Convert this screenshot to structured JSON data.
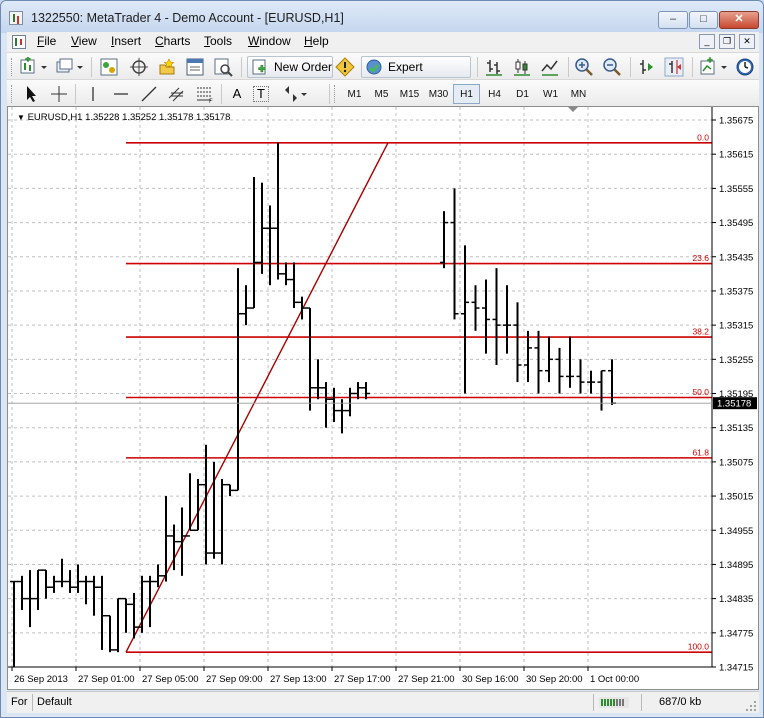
{
  "window": {
    "title": "1322550: MetaTrader 4 - Demo Account - [EURUSD,H1]",
    "minimize_glyph": "–",
    "maximize_glyph": "□",
    "close_glyph": "✕"
  },
  "menu": {
    "items": [
      "File",
      "View",
      "Insert",
      "Charts",
      "Tools",
      "Window",
      "Help"
    ],
    "mdi_min": "_",
    "mdi_restore": "❐",
    "mdi_close": "✕"
  },
  "toolbar": {
    "new_order_label": "New Order",
    "expert_advisors_label": "Expert Advisors",
    "timeframes": [
      "M1",
      "M5",
      "M15",
      "M30",
      "H1",
      "H4",
      "D1",
      "W1",
      "MN"
    ],
    "active_timeframe": "H1",
    "text_tool_label": "A",
    "label_tool_label": "T"
  },
  "icons": {
    "new_chart": "new-chart-icon",
    "profiles": "profiles-icon",
    "market_watch": "market-watch-icon",
    "navigator": "navigator-icon",
    "favorites": "favorites-icon",
    "terminal": "terminal-icon",
    "tester": "tester-icon",
    "zoom_in": "zoom-in-icon",
    "zoom_out": "zoom-out-icon",
    "clock": "clock-icon"
  },
  "colors": {
    "fib_line": "#cc0000",
    "candle": "#000000",
    "grid": "#c0c0c0",
    "price_label_bg": "#000000"
  },
  "chart_data": {
    "type": "ohlc-bar",
    "symbol_header": "EURUSD,H1  1.35228 1.35252 1.35178 1.35178",
    "current_price": "1.35178",
    "y_ticks": [
      "1.35675",
      "1.35615",
      "1.35555",
      "1.35495",
      "1.35435",
      "1.35375",
      "1.35315",
      "1.35255",
      "1.35195",
      "1.35135",
      "1.35075",
      "1.35015",
      "1.34955",
      "1.34895",
      "1.34835",
      "1.34775",
      "1.34715"
    ],
    "y_range": [
      1.34715,
      1.35675
    ],
    "x_ticks": [
      "26 Sep 2013",
      "27 Sep 01:00",
      "27 Sep 05:00",
      "27 Sep 09:00",
      "27 Sep 13:00",
      "27 Sep 17:00",
      "27 Sep 21:00",
      "30 Sep 16:00",
      "30 Sep 20:00",
      "1 Oct 00:00"
    ],
    "fibonacci": {
      "levels": [
        {
          "label": "0.0",
          "price": 1.35635
        },
        {
          "label": "23.6",
          "price": 1.35423
        },
        {
          "label": "38.2",
          "price": 1.35294
        },
        {
          "label": "50.0",
          "price": 1.35188
        },
        {
          "label": "61.8",
          "price": 1.35082
        },
        {
          "label": "100.0",
          "price": 1.34741
        }
      ],
      "trendline": {
        "from_bar": 12,
        "from_price": 1.34741,
        "to_bar": 35.5,
        "to_price": 1.35635
      }
    },
    "bars": [
      [
        1.34865,
        1.34865,
        1.34715,
        1.34865
      ],
      [
        1.34865,
        1.34875,
        1.34815,
        1.34835
      ],
      [
        1.34835,
        1.34885,
        1.34785,
        1.34835
      ],
      [
        1.34835,
        1.34885,
        1.34815,
        1.34885
      ],
      [
        1.34885,
        1.34885,
        1.34835,
        1.34855
      ],
      [
        1.34855,
        1.34875,
        1.34845,
        1.34865
      ],
      [
        1.34865,
        1.34905,
        1.34855,
        1.34865
      ],
      [
        1.34865,
        1.34885,
        1.34845,
        1.34855
      ],
      [
        1.34855,
        1.34895,
        1.34845,
        1.34865
      ],
      [
        1.34865,
        1.34875,
        1.34825,
        1.34865
      ],
      [
        1.34865,
        1.34875,
        1.34805,
        1.34855
      ],
      [
        1.34855,
        1.34875,
        1.34745,
        1.34805
      ],
      [
        1.34805,
        1.34805,
        1.34741,
        1.34745
      ],
      [
        1.34745,
        1.34835,
        1.34741,
        1.34835
      ],
      [
        1.34835,
        1.34835,
        1.34775,
        1.34825
      ],
      [
        1.34825,
        1.34845,
        1.34765,
        1.34785
      ],
      [
        1.34785,
        1.34875,
        1.34775,
        1.34865
      ],
      [
        1.34865,
        1.34875,
        1.34785,
        1.34865
      ],
      [
        1.34865,
        1.34895,
        1.34855,
        1.34875
      ],
      [
        1.34875,
        1.35015,
        1.34865,
        1.34945
      ],
      [
        1.34945,
        1.34965,
        1.34885,
        1.34935
      ],
      [
        1.34935,
        1.34995,
        1.34875,
        1.34945
      ],
      [
        1.34945,
        1.35055,
        1.34955,
        1.34955
      ],
      [
        1.34955,
        1.35045,
        1.34955,
        1.35035
      ],
      [
        1.35035,
        1.35105,
        1.34895,
        1.34915
      ],
      [
        1.34915,
        1.35075,
        1.34905,
        1.34915
      ],
      [
        1.34915,
        1.35045,
        1.34895,
        1.35035
      ],
      [
        1.35035,
        1.35035,
        1.35015,
        1.35025
      ],
      [
        1.35025,
        1.35415,
        1.35025,
        1.35335
      ],
      [
        1.35335,
        1.35385,
        1.35315,
        1.35345
      ],
      [
        1.35345,
        1.35575,
        1.35345,
        1.35425
      ],
      [
        1.35425,
        1.35565,
        1.35405,
        1.35485
      ],
      [
        1.35485,
        1.35525,
        1.35385,
        1.35485
      ],
      [
        1.35485,
        1.35635,
        1.35395,
        1.35405
      ],
      [
        1.35405,
        1.35425,
        1.35385,
        1.35395
      ],
      [
        1.35395,
        1.35425,
        1.35345,
        1.35355
      ],
      [
        1.35355,
        1.35365,
        1.35325,
        1.35345
      ],
      [
        1.35345,
        1.35345,
        1.35165,
        1.35205
      ],
      [
        1.35205,
        1.35255,
        1.35185,
        1.35205
      ],
      [
        1.35205,
        1.35215,
        1.35135,
        1.35185
      ],
      [
        1.35185,
        1.35205,
        1.35145,
        1.35165
      ],
      [
        1.35165,
        1.35185,
        1.35125,
        1.35165
      ],
      [
        1.35165,
        1.35205,
        1.35155,
        1.35195
      ],
      [
        1.35195,
        1.35215,
        1.35185,
        1.35205
      ],
      [
        1.35205,
        1.35215,
        1.35185,
        1.35195
      ],
      [
        1.35425,
        1.35515,
        1.35415,
        1.35495
      ],
      [
        1.35495,
        1.35555,
        1.35325,
        1.35335
      ],
      [
        1.35335,
        1.35455,
        1.35195,
        1.35355
      ],
      [
        1.35355,
        1.35385,
        1.35305,
        1.35345
      ],
      [
        1.35345,
        1.35395,
        1.35265,
        1.35325
      ],
      [
        1.35325,
        1.35415,
        1.35245,
        1.35315
      ],
      [
        1.35315,
        1.35385,
        1.35265,
        1.35315
      ],
      [
        1.35315,
        1.35355,
        1.35215,
        1.35245
      ],
      [
        1.35245,
        1.35305,
        1.35215,
        1.35275
      ],
      [
        1.35275,
        1.35305,
        1.35195,
        1.35235
      ],
      [
        1.35235,
        1.35295,
        1.35215,
        1.35255
      ],
      [
        1.35255,
        1.35275,
        1.35195,
        1.35225
      ],
      [
        1.35225,
        1.35295,
        1.35205,
        1.35225
      ],
      [
        1.35225,
        1.35255,
        1.35195,
        1.35215
      ],
      [
        1.35215,
        1.35235,
        1.35195,
        1.35215
      ],
      [
        1.35215,
        1.35235,
        1.35165,
        1.35235
      ],
      [
        1.35235,
        1.35255,
        1.35175,
        1.35178
      ]
    ]
  },
  "status": {
    "help": "For",
    "profile": "Default",
    "traffic": "687/0 kb"
  }
}
